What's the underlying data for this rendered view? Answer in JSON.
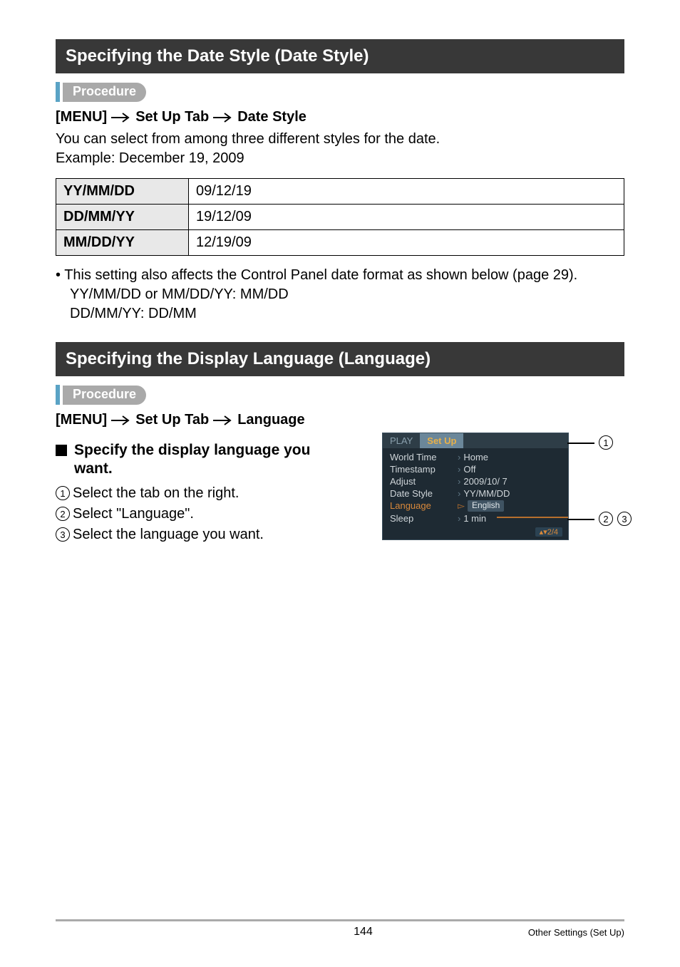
{
  "section1": {
    "title": "Specifying the Date Style (Date Style)",
    "procedure_label": "Procedure",
    "path": {
      "p1": "[MENU]",
      "p2": "Set Up Tab",
      "p3": "Date Style"
    },
    "desc_line1": "You can select from among three different styles for the date.",
    "desc_line2": "Example: December 19, 2009",
    "table": {
      "rows": [
        {
          "fmt": "YY/MM/DD",
          "ex": "09/12/19"
        },
        {
          "fmt": "DD/MM/YY",
          "ex": "19/12/09"
        },
        {
          "fmt": "MM/DD/YY",
          "ex": "12/19/09"
        }
      ]
    },
    "note_bullet": "• ",
    "note_l1": "This setting also affects the Control Panel date format as shown below (page 29).",
    "note_l2": "YY/MM/DD or MM/DD/YY: MM/DD",
    "note_l3": "DD/MM/YY: DD/MM"
  },
  "section2": {
    "title": "Specifying the Display Language (Language)",
    "procedure_label": "Procedure",
    "path": {
      "p1": "[MENU]",
      "p2": "Set Up Tab",
      "p3": "Language"
    },
    "subhead_l1": "Specify the display language you",
    "subhead_l2": "want.",
    "steps": {
      "s1": "Select the tab on the right.",
      "s2": "Select \"Language\".",
      "s3": "Select the language you want."
    },
    "camera": {
      "tab_play": "PLAY",
      "tab_setup": "Set Up",
      "rows": [
        {
          "label": "World Time",
          "val": "Home"
        },
        {
          "label": "Timestamp",
          "val": "Off"
        },
        {
          "label": "Adjust",
          "val": "2009/10/ 7"
        },
        {
          "label": "Date Style",
          "val": "YY/MM/DD"
        },
        {
          "label": "Language",
          "val": "English",
          "highlight": true,
          "box": true
        },
        {
          "label": "Sleep",
          "val": "1 min"
        }
      ],
      "page_indicator": "▴▾2/4"
    },
    "callouts": {
      "c1": "1",
      "c2": "2",
      "c3": "3"
    }
  },
  "footer": {
    "page": "144",
    "section": "Other Settings (Set Up)"
  }
}
